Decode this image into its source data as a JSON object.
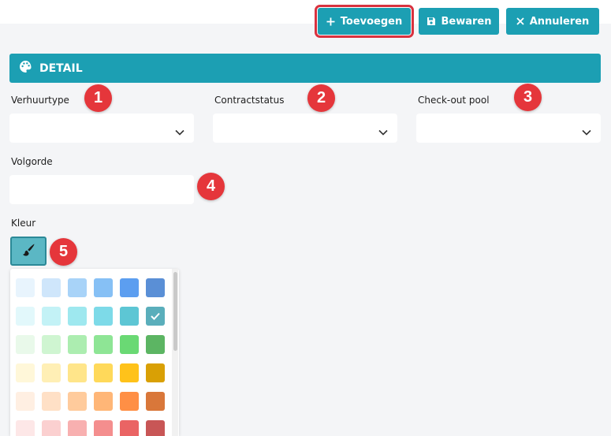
{
  "toolbar": {
    "add_label": "Toevoegen",
    "save_label": "Bewaren",
    "cancel_label": "Annuleren"
  },
  "section": {
    "title": "DETAIL"
  },
  "fields": {
    "verhuurtype": {
      "label": "Verhuurtype",
      "value": ""
    },
    "contractstatus": {
      "label": "Contractstatus",
      "value": ""
    },
    "checkout_pool": {
      "label": "Check-out pool",
      "value": ""
    },
    "volgorde": {
      "label": "Volgorde",
      "value": ""
    },
    "kleur": {
      "label": "Kleur"
    }
  },
  "markers": [
    "1",
    "2",
    "3",
    "4",
    "5"
  ],
  "colors": {
    "accent": "#1c9fb3",
    "marker": "#e5363b",
    "highlight_outline": "#d9323f"
  },
  "palette": {
    "selected": "#5aaebb",
    "rows": [
      [
        "#e8f4fd",
        "#cfe6fb",
        "#a8d3f8",
        "#86c0f5",
        "#5c9ef0",
        "#5a8fd6"
      ],
      [
        "#e2f8fb",
        "#c3f2f6",
        "#9ee8ef",
        "#7ddae8",
        "#5dc6d4",
        "#5aaebb"
      ],
      [
        "#e9f9ea",
        "#cff5d1",
        "#acedb0",
        "#8ee595",
        "#6ad974",
        "#5cb563"
      ],
      [
        "#fff7d9",
        "#ffefb5",
        "#ffe58a",
        "#ffd95a",
        "#ffc21a",
        "#d9a005"
      ],
      [
        "#ffefe2",
        "#ffe0c6",
        "#ffcb9c",
        "#ffb677",
        "#ff8f45",
        "#d9773a"
      ],
      [
        "#fde7e7",
        "#fbd0d0",
        "#f8b0b0",
        "#f48e8e",
        "#ea6464",
        "#c85656"
      ]
    ]
  }
}
